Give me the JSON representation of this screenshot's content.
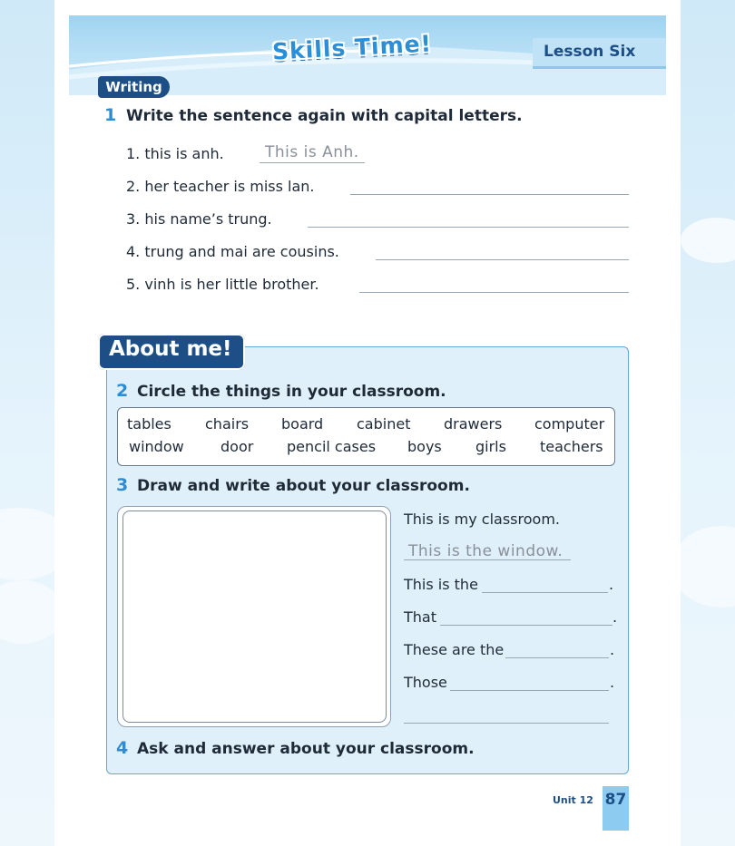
{
  "banner": {
    "title": "Skills Time!",
    "lesson": "Lesson Six"
  },
  "section_tag": "Writing",
  "ex1": {
    "num": "1",
    "instruction": "Write the sentence again with capital letters.",
    "items": [
      {
        "n": "1.",
        "text": "this is anh.",
        "answer": "This is Anh."
      },
      {
        "n": "2.",
        "text": "her teacher is miss lan.",
        "answer": ""
      },
      {
        "n": "3.",
        "text": "his name’s trung.",
        "answer": ""
      },
      {
        "n": "4.",
        "text": "trung and mai are cousins.",
        "answer": ""
      },
      {
        "n": "5.",
        "text": "vinh is her little brother.",
        "answer": ""
      }
    ]
  },
  "about": {
    "title": "About me!"
  },
  "ex2": {
    "num": "2",
    "instruction": "Circle the things in your classroom.",
    "row1": [
      "tables",
      "chairs",
      "board",
      "cabinet",
      "drawers",
      "computer"
    ],
    "row2": [
      "window",
      "door",
      "pencil cases",
      "boys",
      "girls",
      "teachers"
    ]
  },
  "ex3": {
    "num": "3",
    "instruction": "Draw and write about your classroom.",
    "lines": {
      "l1": "This is my classroom.",
      "l2": "This is the window.",
      "l3": "This is the",
      "l4": "That",
      "l5": "These are the",
      "l6": "Those",
      "dot": "."
    }
  },
  "ex4": {
    "num": "4",
    "instruction": "Ask and answer about your classroom."
  },
  "footer": {
    "unit": "Unit 12",
    "page": "87"
  },
  "colors": {
    "navy": "#1d4f86",
    "accent_blue": "#2f8bd2",
    "box_fill": "#dff0fb"
  }
}
